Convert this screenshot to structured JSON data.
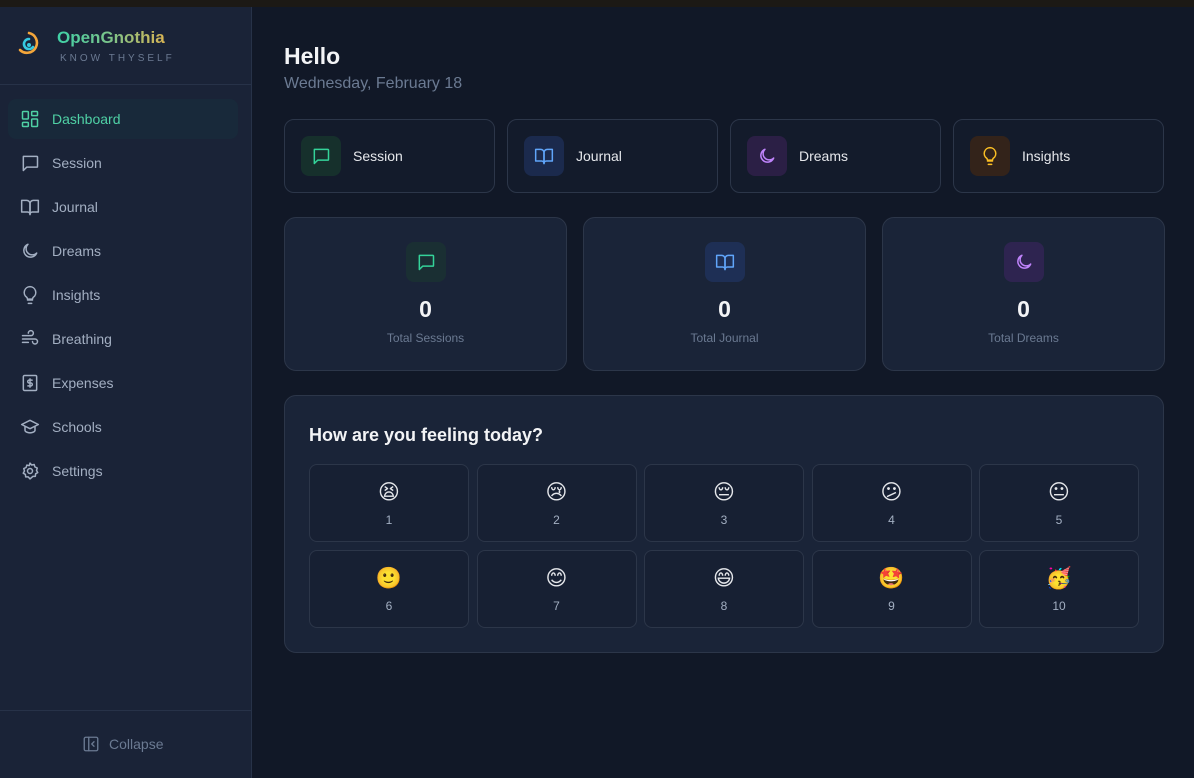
{
  "app": {
    "name": "OpenGnothia",
    "tagline": "KNOW THYSELF"
  },
  "sidebar": {
    "items": [
      {
        "label": "Dashboard",
        "icon": "dashboard-icon",
        "active": true
      },
      {
        "label": "Session",
        "icon": "message-icon"
      },
      {
        "label": "Journal",
        "icon": "book-icon"
      },
      {
        "label": "Dreams",
        "icon": "moon-icon"
      },
      {
        "label": "Insights",
        "icon": "lightbulb-icon"
      },
      {
        "label": "Breathing",
        "icon": "wind-icon"
      },
      {
        "label": "Expenses",
        "icon": "dollar-icon"
      },
      {
        "label": "Schools",
        "icon": "graduation-cap-icon"
      },
      {
        "label": "Settings",
        "icon": "gear-icon"
      }
    ],
    "collapse_label": "Collapse"
  },
  "header": {
    "greeting": "Hello",
    "date": "Wednesday, February 18"
  },
  "quick_actions": [
    {
      "label": "Session",
      "icon": "message-icon",
      "color": "#34d399"
    },
    {
      "label": "Journal",
      "icon": "book-icon",
      "color": "#60a5fa"
    },
    {
      "label": "Dreams",
      "icon": "moon-icon",
      "color": "#c084fc"
    },
    {
      "label": "Insights",
      "icon": "lightbulb-icon",
      "color": "#fbbf24"
    }
  ],
  "stats": [
    {
      "value": "0",
      "label": "Total Sessions",
      "icon": "message-icon",
      "color": "#34d399"
    },
    {
      "value": "0",
      "label": "Total Journal",
      "icon": "book-icon",
      "color": "#60a5fa"
    },
    {
      "value": "0",
      "label": "Total Dreams",
      "icon": "moon-icon",
      "color": "#c084fc"
    }
  ],
  "mood": {
    "title": "How are you feeling today?",
    "options": [
      {
        "emoji": "😫",
        "value": "1"
      },
      {
        "emoji": "😢",
        "value": "2"
      },
      {
        "emoji": "😔",
        "value": "3"
      },
      {
        "emoji": "😕",
        "value": "4"
      },
      {
        "emoji": "😐",
        "value": "5"
      },
      {
        "emoji": "🙂",
        "value": "6"
      },
      {
        "emoji": "😊",
        "value": "7"
      },
      {
        "emoji": "😄",
        "value": "8"
      },
      {
        "emoji": "🤩",
        "value": "9"
      },
      {
        "emoji": "🥳",
        "value": "10"
      }
    ]
  },
  "colors": {
    "accent": "#4fd1a5",
    "background": "#111827",
    "sidebar": "#1a2337",
    "card": "#1a2438"
  }
}
